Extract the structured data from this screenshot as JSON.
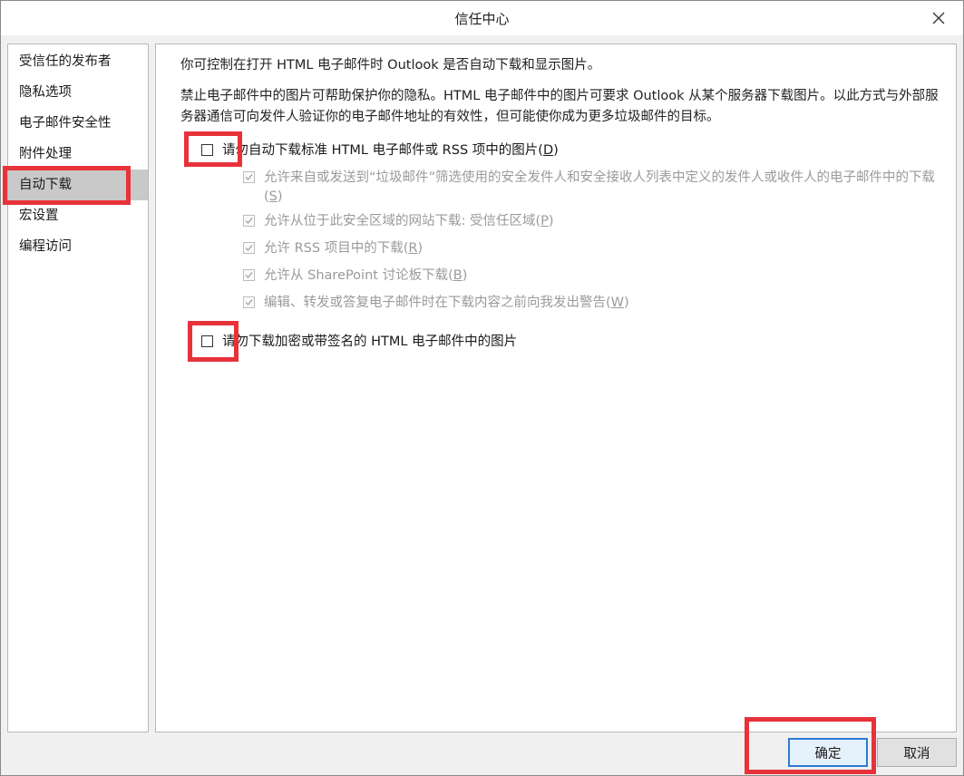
{
  "window": {
    "title": "信任中心"
  },
  "sidebar": {
    "items": [
      {
        "label": "受信任的发布者"
      },
      {
        "label": "隐私选项"
      },
      {
        "label": "电子邮件安全性"
      },
      {
        "label": "附件处理"
      },
      {
        "label": "自动下载",
        "selected": true
      },
      {
        "label": "宏设置"
      },
      {
        "label": "编程访问"
      }
    ]
  },
  "content": {
    "intro": "你可控制在打开 HTML 电子邮件时 Outlook 是否自动下载和显示图片。",
    "description": "禁止电子邮件中的图片可帮助保护你的隐私。HTML 电子邮件中的图片可要求 Outlook 从某个服务器下载图片。以此方式与外部服务器通信可向发件人验证你的电子邮件地址的有效性，但可能使你成为更多垃圾邮件的目标。",
    "options": {
      "no_auto_download": {
        "text": "请勿自动下载标准 HTML 电子邮件或 RSS 项中的图片(",
        "key": "D",
        "end": ")",
        "checked": false
      },
      "safe_senders": {
        "text": "允许来自或发送到“垃圾邮件”筛选使用的安全发件人和安全接收人列表中定义的发件人或收件人的电子邮件中的下载(",
        "key": "S",
        "end": ")",
        "checked": true,
        "disabled": true
      },
      "trusted_zone": {
        "text": "允许从位于此安全区域的网站下载: 受信任区域(",
        "key": "P",
        "end": ")",
        "checked": true,
        "disabled": true
      },
      "rss": {
        "text": "允许 RSS 项目中的下载(",
        "key": "R",
        "end": ")",
        "checked": true,
        "disabled": true
      },
      "sharepoint": {
        "text": "允许从 SharePoint 讨论板下载(",
        "key": "B",
        "end": ")",
        "checked": true,
        "disabled": true
      },
      "warn_before": {
        "text": "编辑、转发或答复电子邮件时在下载内容之前向我发出警告(",
        "key": "W",
        "end": ")",
        "checked": true,
        "disabled": true
      },
      "no_encrypted": {
        "text": "请勿下载加密或带签名的 HTML 电子邮件中的图片",
        "checked": false
      }
    }
  },
  "buttons": {
    "ok": "确定",
    "cancel": "取消"
  },
  "colors": {
    "highlight": "#e8323a",
    "selected_nav": "#c9c9c9",
    "primary_border": "#2d7bd5"
  },
  "icons": {
    "close": "close-icon",
    "check": "checkmark-icon"
  }
}
